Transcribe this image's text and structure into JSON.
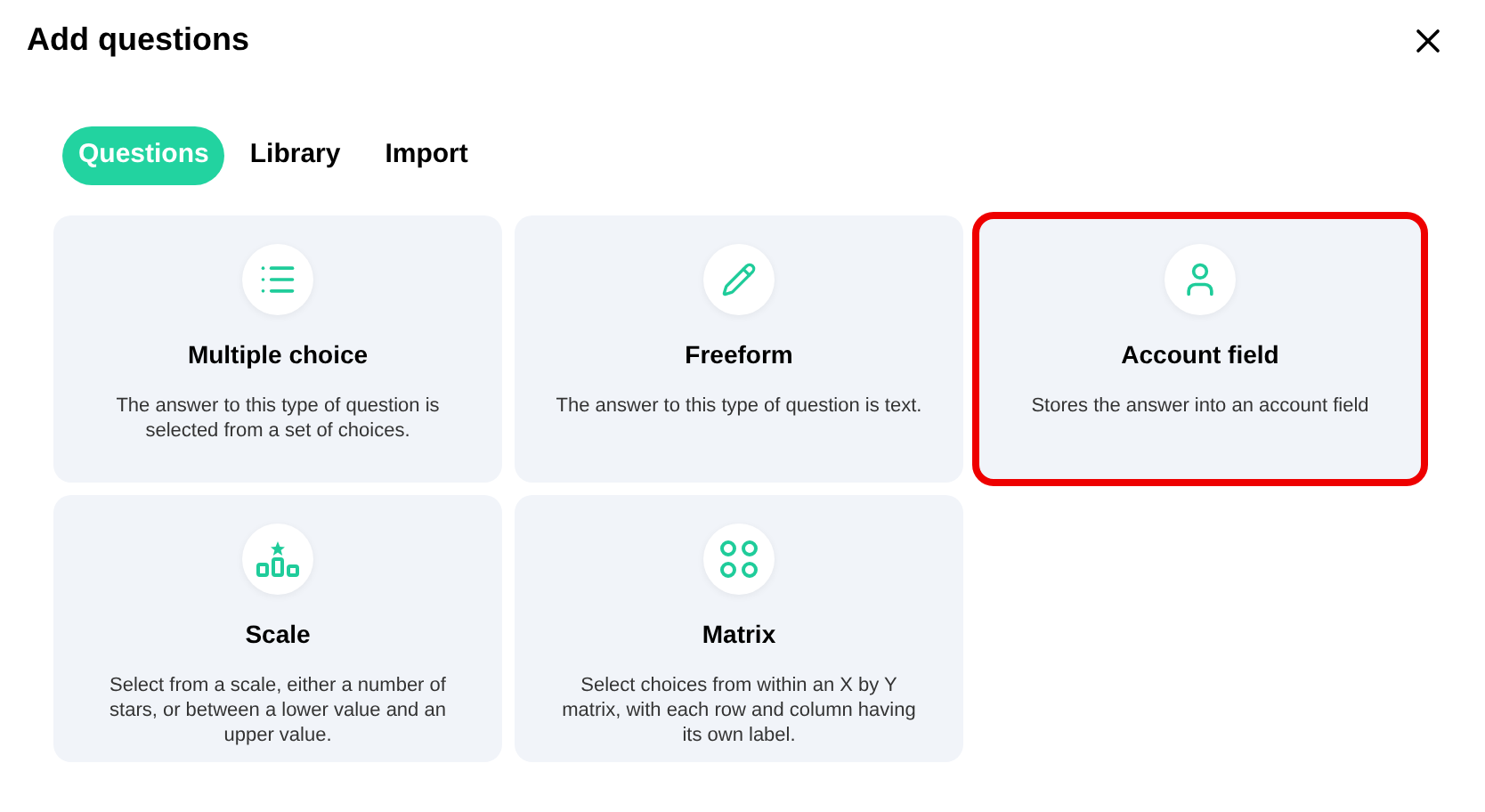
{
  "title": "Add questions",
  "tabs": [
    {
      "label": "Questions",
      "selected": true
    },
    {
      "label": "Library",
      "selected": false
    },
    {
      "label": "Import",
      "selected": false
    }
  ],
  "cards": [
    {
      "kind": "list",
      "title": "Multiple choice",
      "description": "The answer to this type of question is selected from a set of choices.",
      "highlighted": false
    },
    {
      "kind": "pencil",
      "title": "Freeform",
      "description": "The answer to this type of question is text.",
      "highlighted": false
    },
    {
      "kind": "user",
      "title": "Account field",
      "description": "Stores the answer into an account field",
      "highlighted": true
    },
    {
      "kind": "scale",
      "title": "Scale",
      "description": "Select from a scale, either a number of stars, or between a lower value and an upper value.",
      "highlighted": false
    },
    {
      "kind": "matrix",
      "title": "Matrix",
      "description": "Select choices from within an X by Y matrix, with each row and column having its own label.",
      "highlighted": false
    }
  ]
}
